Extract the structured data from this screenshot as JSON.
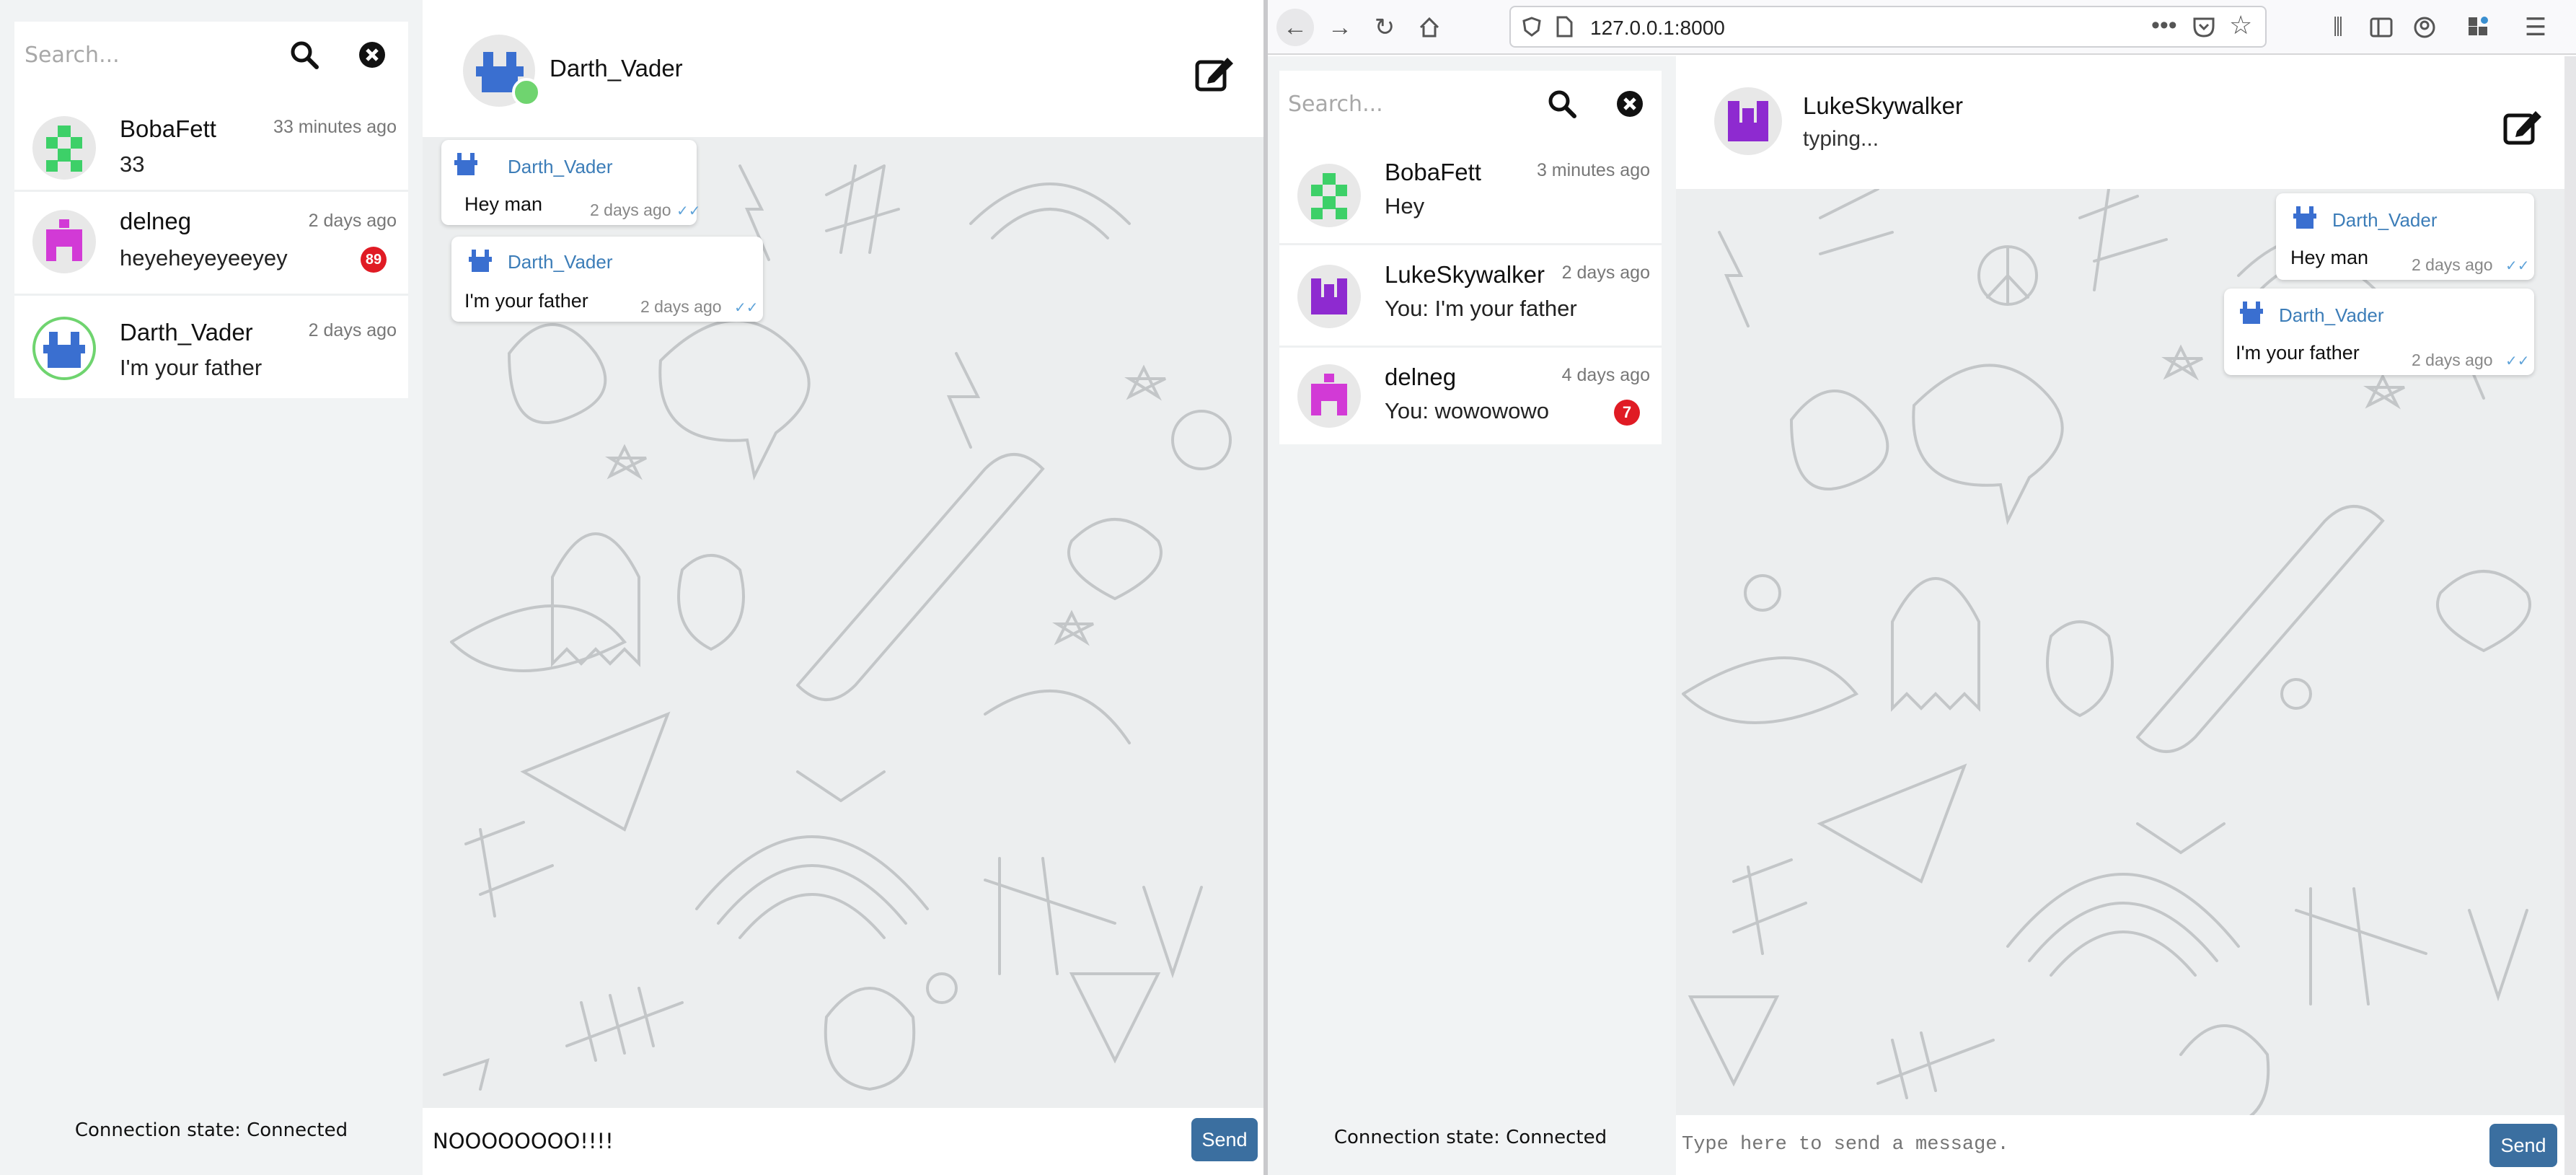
{
  "left": {
    "search": {
      "placeholder": "Search..."
    },
    "contacts": [
      {
        "name": "BobaFett",
        "time": "33 minutes ago",
        "preview": "33",
        "unread": ""
      },
      {
        "name": "delneg",
        "time": "2 days ago",
        "preview": "heyeheyeyeeyey",
        "unread": "89"
      },
      {
        "name": "Darth_Vader",
        "time": "2 days ago",
        "preview": "I'm your father",
        "unread": ""
      }
    ],
    "connection": "Connection state: Connected",
    "chat": {
      "title": "Darth_Vader",
      "messages": [
        {
          "author": "Darth_Vader",
          "text": "Hey man",
          "time": "2 days ago"
        },
        {
          "author": "Darth_Vader",
          "text": "I'm your father",
          "time": "2 days ago"
        }
      ],
      "composer_value": "NOOOOOOOO!!!!",
      "send_label": "Send"
    }
  },
  "browser": {
    "url": "127.0.0.1:8000"
  },
  "right": {
    "search": {
      "placeholder": "Search..."
    },
    "contacts": [
      {
        "name": "BobaFett",
        "time": "3 minutes ago",
        "preview": "Hey",
        "unread": ""
      },
      {
        "name": "LukeSkywalker",
        "time": "2 days ago",
        "preview": "You: I'm your father",
        "unread": ""
      },
      {
        "name": "delneg",
        "time": "4 days ago",
        "preview": "You: wowowowo",
        "unread": "7"
      }
    ],
    "connection": "Connection state: Connected",
    "chat": {
      "title": "LukeSkywalker",
      "status": "typing...",
      "messages": [
        {
          "author": "Darth_Vader",
          "text": "Hey man",
          "time": "2 days ago"
        },
        {
          "author": "Darth_Vader",
          "text": "I'm your father",
          "time": "2 days ago"
        }
      ],
      "composer_placeholder": "Type here to send a message.",
      "send_label": "Send"
    }
  },
  "colors": {
    "boba": "#3dd068",
    "delneg": "#d23ad6",
    "vader": "#3a6fd0",
    "luke": "#8e2ad0",
    "online": "#6fd46f",
    "badge": "#e01b24",
    "send": "#3b6fa0",
    "link": "#3c7db8"
  }
}
